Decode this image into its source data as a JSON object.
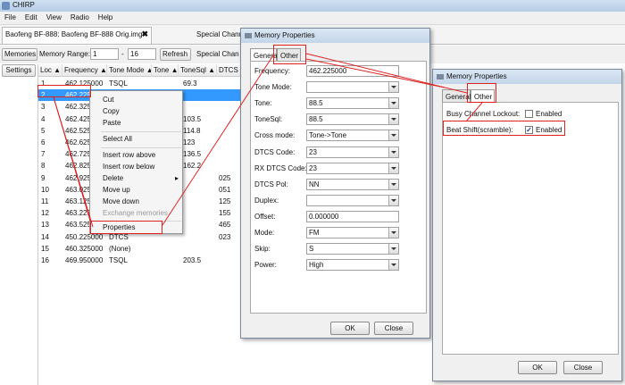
{
  "app": {
    "title": "CHIRP"
  },
  "menubar": [
    "File",
    "Edit",
    "View",
    "Radio",
    "Help"
  ],
  "tab": {
    "label": "Baofeng BF-888: Baofeng BF-888 Orig.img*",
    "close": "✖"
  },
  "tabrow": {
    "rest": "Special Chann"
  },
  "controls": {
    "memories": "Memories",
    "range_label": "Memory Range:",
    "range_from": "1",
    "range_to": "16",
    "refresh": "Refresh",
    "special": "Special Chan"
  },
  "settings_btn": "Settings",
  "headers": [
    "Loc ▲",
    "Frequency ▲",
    "Tone Mode ▲",
    "Tone ▲",
    "ToneSql ▲",
    "DTCS C"
  ],
  "rows": [
    {
      "loc": "1",
      "freq": "462.125000",
      "mode": "TSQL",
      "tone": "",
      "tonesql": "69.3",
      "dtcs": ""
    },
    {
      "loc": "2",
      "freq": "462.225000",
      "mode": "",
      "tone": "",
      "tonesql": "",
      "dtcs": ""
    },
    {
      "loc": "3",
      "freq": "462.325",
      "mode": "",
      "tone": "",
      "tonesql": "",
      "dtcs": ""
    },
    {
      "loc": "4",
      "freq": "462.425",
      "mode": "",
      "tone": "",
      "tonesql": "103.5",
      "dtcs": ""
    },
    {
      "loc": "5",
      "freq": "462.525",
      "mode": "",
      "tone": "",
      "tonesql": "114.8",
      "dtcs": ""
    },
    {
      "loc": "6",
      "freq": "462.625",
      "mode": "",
      "tone": "",
      "tonesql": "123",
      "dtcs": ""
    },
    {
      "loc": "7",
      "freq": "462.725",
      "mode": "",
      "tone": "",
      "tonesql": "136.5",
      "dtcs": ""
    },
    {
      "loc": "8",
      "freq": "462.825",
      "mode": "",
      "tone": "",
      "tonesql": "162.2",
      "dtcs": ""
    },
    {
      "loc": "9",
      "freq": "462.925",
      "mode": "",
      "tone": "",
      "tonesql": "",
      "dtcs": "025"
    },
    {
      "loc": "10",
      "freq": "463.025",
      "mode": "",
      "tone": "",
      "tonesql": "",
      "dtcs": "051"
    },
    {
      "loc": "11",
      "freq": "463.125",
      "mode": "",
      "tone": "",
      "tonesql": "",
      "dtcs": "125"
    },
    {
      "loc": "12",
      "freq": "463.225",
      "mode": "",
      "tone": "",
      "tonesql": "",
      "dtcs": "155"
    },
    {
      "loc": "13",
      "freq": "463.525000",
      "mode": "DTCS",
      "tone": "",
      "tonesql": "",
      "dtcs": "465"
    },
    {
      "loc": "14",
      "freq": "450.225000",
      "mode": "DTCS",
      "tone": "",
      "tonesql": "",
      "dtcs": "023"
    },
    {
      "loc": "15",
      "freq": "460.325000",
      "mode": "(None)",
      "tone": "",
      "tonesql": "",
      "dtcs": ""
    },
    {
      "loc": "16",
      "freq": "469.950000",
      "mode": "TSQL",
      "tone": "",
      "tonesql": "203.5",
      "dtcs": ""
    }
  ],
  "context_menu": {
    "cut": "Cut",
    "copy": "Copy",
    "paste": "Paste",
    "select_all": "Select All",
    "insert_above": "Insert row above",
    "insert_below": "Insert row below",
    "delete": "Delete",
    "move_up": "Move up",
    "move_down": "Move down",
    "exchange": "Exchange memories",
    "properties": "Properties"
  },
  "dialog1": {
    "title": "Memory Properties",
    "tab_general": "General",
    "tab_other": "Other",
    "fields": [
      {
        "label": "Frequency:",
        "value": "462.225000",
        "type": "text"
      },
      {
        "label": "Tone Mode:",
        "value": "",
        "type": "select"
      },
      {
        "label": "Tone:",
        "value": "88.5",
        "type": "select"
      },
      {
        "label": "ToneSql:",
        "value": "88.5",
        "type": "select"
      },
      {
        "label": "Cross mode:",
        "value": "Tone->Tone",
        "type": "select"
      },
      {
        "label": "DTCS Code:",
        "value": "23",
        "type": "select"
      },
      {
        "label": "RX DTCS Code:",
        "value": "23",
        "type": "select"
      },
      {
        "label": "DTCS Pol:",
        "value": "NN",
        "type": "select"
      },
      {
        "label": "Duplex:",
        "value": "",
        "type": "select"
      },
      {
        "label": "Offset:",
        "value": "0.000000",
        "type": "text"
      },
      {
        "label": "Mode:",
        "value": "FM",
        "type": "select"
      },
      {
        "label": "Skip:",
        "value": "S",
        "type": "select"
      },
      {
        "label": "Power:",
        "value": "High",
        "type": "select"
      }
    ],
    "ok": "OK",
    "close": "Close",
    "close_icon": "x"
  },
  "dialog2": {
    "title": "Memory Properties",
    "tab_general": "General",
    "tab_other": "Other",
    "busy_label": "Busy Channel Lockout:",
    "busy_enabled": "Enabled",
    "beat_label": "Beat Shift(scramble):",
    "beat_enabled": "Enabled",
    "beat_check": "✓",
    "ok": "OK",
    "close": "Close",
    "close_icon": "x"
  },
  "colors": {
    "selection": "#3399ff",
    "annotation": "#dd2222"
  }
}
